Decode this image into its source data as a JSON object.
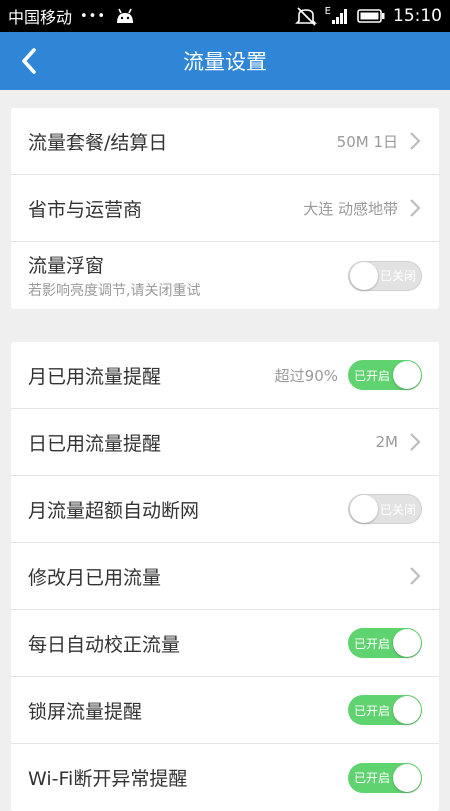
{
  "status_bar": {
    "carrier": "中国移动",
    "dots": "•••",
    "network_label": "E",
    "time": "15:10"
  },
  "app_bar": {
    "title": "流量设置"
  },
  "group1": [
    {
      "label": "流量套餐/结算日",
      "value": "50M 1日"
    },
    {
      "label": "省市与运营商",
      "value": "大连 动感地带"
    },
    {
      "label": "流量浮窗",
      "sub": "若影响亮度调节,请关闭重试",
      "toggle": "已关闭"
    }
  ],
  "group2": [
    {
      "label": "月已用流量提醒",
      "value": "超过90%",
      "toggle": "已开启"
    },
    {
      "label": "日已用流量提醒",
      "value": "2M"
    },
    {
      "label": "月流量超额自动断网",
      "toggle": "已关闭"
    },
    {
      "label": "修改月已用流量"
    },
    {
      "label": "每日自动校正流量",
      "toggle": "已开启"
    },
    {
      "label": "锁屏流量提醒",
      "toggle": "已开启"
    },
    {
      "label": "Wi-Fi断开异常提醒",
      "toggle": "已开启"
    }
  ],
  "colors": {
    "primary": "#2f86d7",
    "toggle_on": "#5fd36f",
    "toggle_off": "#e2e2e2",
    "background": "#efefef"
  }
}
